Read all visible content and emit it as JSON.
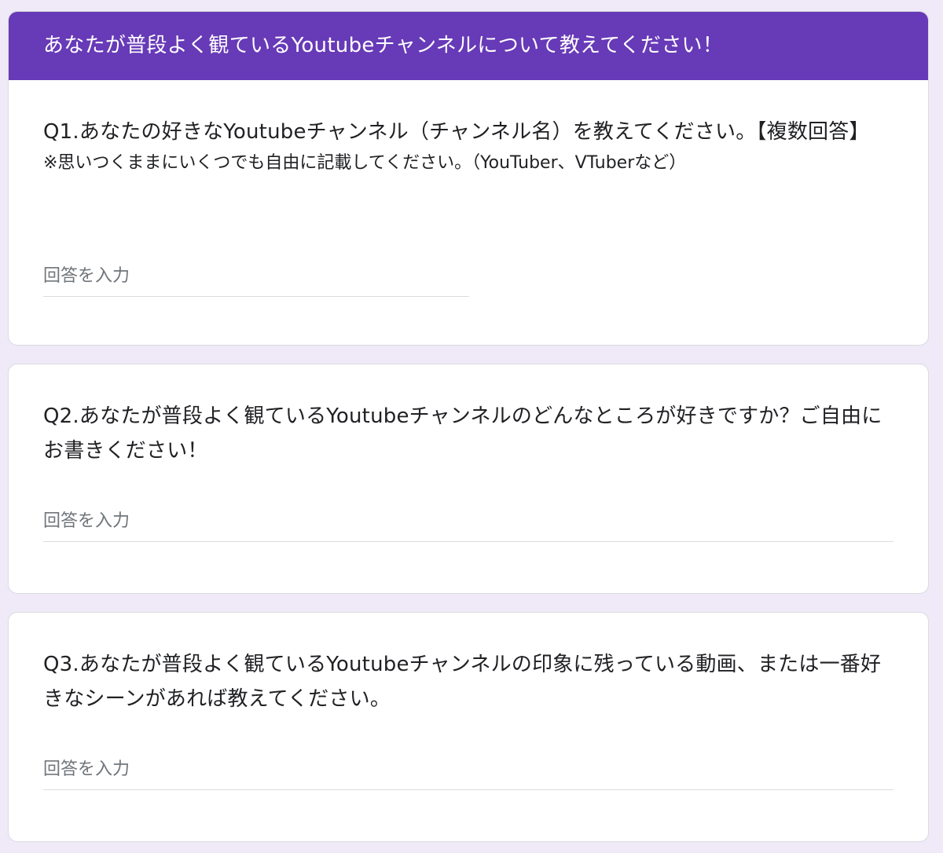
{
  "theme": {
    "accent": "#673ab7",
    "background": "#efe9f8"
  },
  "section": {
    "title": "あなたが普段よく観ているYoutubeチャンネルについて教えてください！"
  },
  "questions": [
    {
      "title": "Q1.あなたの好きなYoutubeチャンネル（チャンネル名）を教えてください。【複数回答】",
      "description": "※思いつくままにいくつでも自由に記載してください。（YouTuber、VTuberなど）",
      "placeholder": "回答を入力"
    },
    {
      "title": "Q2.あなたが普段よく観ているYoutubeチャンネルのどんなところが好きですか？ご自由にお書きください！",
      "placeholder": "回答を入力"
    },
    {
      "title": "Q3.あなたが普段よく観ているYoutubeチャンネルの印象に残っている動画、または一番好きなシーンがあれば教えてください。",
      "placeholder": "回答を入力"
    }
  ]
}
